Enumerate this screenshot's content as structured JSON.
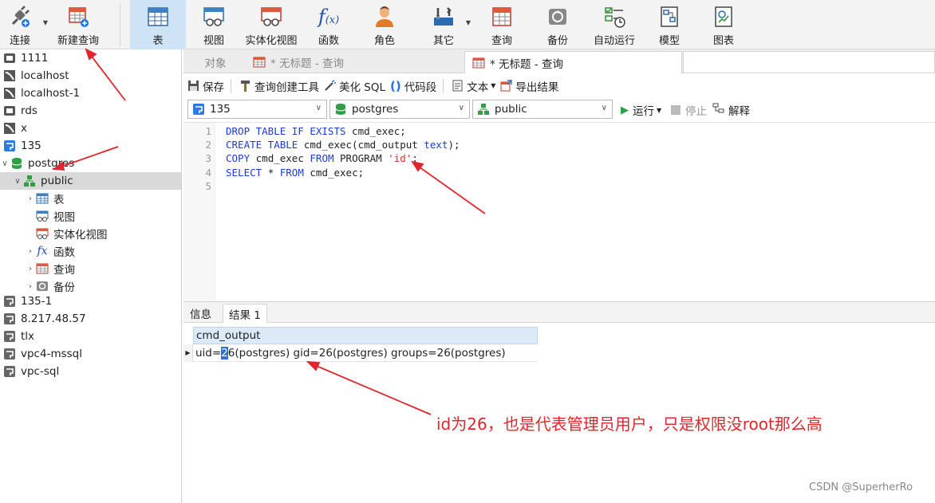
{
  "toolbar": {
    "connect": "连接",
    "new_query": "新建查询",
    "table": "表",
    "view": "视图",
    "mat_view": "实体化视图",
    "function": "函数",
    "role": "角色",
    "other": "其它",
    "query": "查询",
    "backup": "备份",
    "auto_run": "自动运行",
    "model": "模型",
    "chart": "图表"
  },
  "sidebar": {
    "items": [
      {
        "label": "1111"
      },
      {
        "label": "localhost"
      },
      {
        "label": "localhost-1"
      },
      {
        "label": "rds"
      },
      {
        "label": "x"
      },
      {
        "label": "135"
      },
      {
        "label": "postgres"
      },
      {
        "label": "public"
      },
      {
        "label": "表"
      },
      {
        "label": "视图"
      },
      {
        "label": "实体化视图"
      },
      {
        "label": "函数"
      },
      {
        "label": "查询"
      },
      {
        "label": "备份"
      },
      {
        "label": "135-1"
      },
      {
        "label": "8.217.48.57"
      },
      {
        "label": "tlx"
      },
      {
        "label": "vpc4-mssql"
      },
      {
        "label": "vpc-sql"
      }
    ]
  },
  "tabs": {
    "objects": "对象",
    "tab1": "* 无标题 - 查询",
    "tab2": "* 无标题 - 查询"
  },
  "editor_toolbar": {
    "save": "保存",
    "query_builder": "查询创建工具",
    "beautify": "美化 SQL",
    "snippet": "代码段",
    "text": "文本",
    "export": "导出结果"
  },
  "selectors": {
    "connection": "135",
    "database": "postgres",
    "schema": "public",
    "run": "运行",
    "stop": "停止",
    "explain": "解释"
  },
  "editor": {
    "line_numbers": [
      "1",
      "2",
      "3",
      "4",
      "5"
    ]
  },
  "results": {
    "tab_info": "信息",
    "tab_result": "结果 1",
    "column": "cmd_output",
    "row_pre": "uid=",
    "row_hl": "2",
    "row_post": "6(postgres) gid=26(postgres) groups=26(postgres)"
  },
  "annotation": "id为26，也是代表管理员用户，只是权限没root那么高",
  "watermark": "CSDN @SuperherRo"
}
